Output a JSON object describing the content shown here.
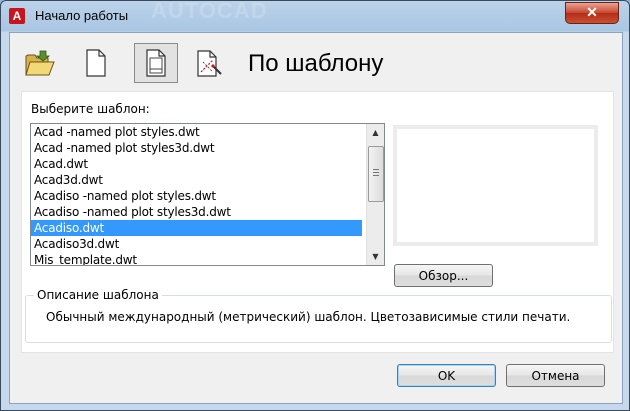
{
  "window": {
    "title": "Начало работы",
    "background_brand": "AUTOCAD",
    "close_label": "✕",
    "logo_letter": "A"
  },
  "toolbar": {
    "tools": [
      {
        "name": "open-drawing",
        "icon": "folder-open-icon"
      },
      {
        "name": "start-from-scratch",
        "icon": "blank-page-icon"
      },
      {
        "name": "use-template",
        "icon": "template-page-icon"
      },
      {
        "name": "use-wizard",
        "icon": "wizard-icon"
      }
    ],
    "mode_title": "По шаблону"
  },
  "template_list": {
    "label": "Выберите шаблон:",
    "items": [
      "Acad -named plot styles.dwt",
      "Acad -named plot styles3d.dwt",
      "Acad.dwt",
      "Acad3d.dwt",
      "Acadiso -named plot styles.dwt",
      "Acadiso -named plot styles3d.dwt",
      "Acadiso.dwt",
      "Acadiso3d.dwt",
      "Mis_template.dwt"
    ],
    "selected": "Acadiso.dwt"
  },
  "browse_label": "Обзор...",
  "description": {
    "title": "Описание шаблона",
    "text": "Обычный международный (метрический) шаблон. Цветозависимые стили печати."
  },
  "buttons": {
    "ok": "OK",
    "cancel": "Отмена"
  },
  "colors": {
    "selection": "#3399ff",
    "autocad_red": "#c8141c"
  }
}
